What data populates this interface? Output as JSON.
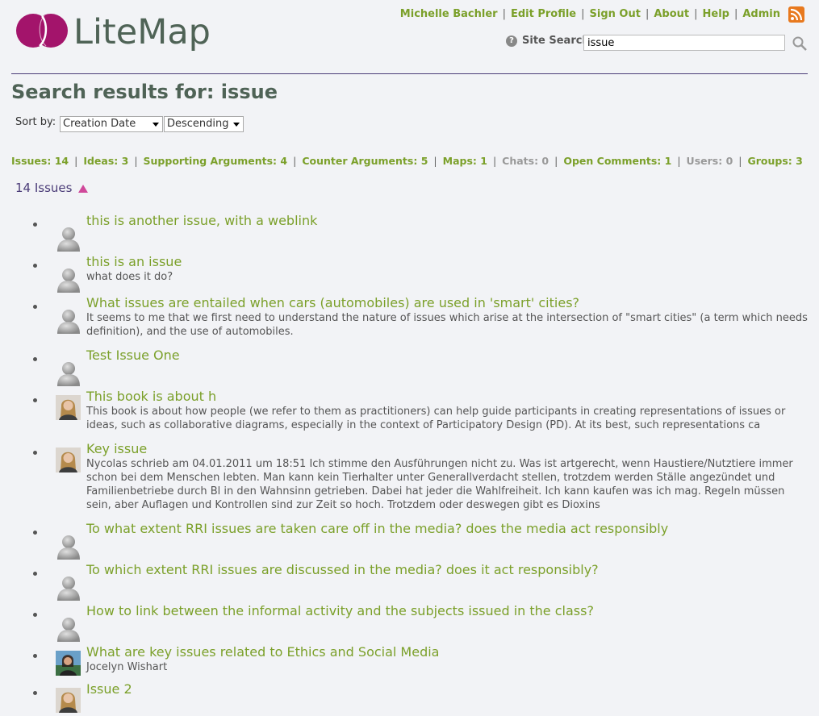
{
  "app": {
    "logo_text": "LiteMap"
  },
  "topnav": {
    "user": "Michelle Bachler",
    "edit_profile": "Edit Profile",
    "sign_out": "Sign Out",
    "about": "About",
    "help": "Help",
    "admin": "Admin"
  },
  "search": {
    "help_glyph": "?",
    "label": "Site Search",
    "value": "issue"
  },
  "page": {
    "title": "Search results for: issue"
  },
  "sort": {
    "label": "Sort by:",
    "field": "Creation Date",
    "order": "Descending"
  },
  "counts": [
    {
      "label": "Issues: 14",
      "active": true
    },
    {
      "label": "Ideas: 3",
      "active": true
    },
    {
      "label": "Supporting Arguments: 4",
      "active": true
    },
    {
      "label": "Counter Arguments: 5",
      "active": true
    },
    {
      "label": "Maps: 1",
      "active": true
    },
    {
      "label": "Chats: 0",
      "active": false
    },
    {
      "label": "Open Comments: 1",
      "active": true
    },
    {
      "label": "Users: 0",
      "active": false
    },
    {
      "label": "Groups: 3",
      "active": true
    }
  ],
  "section": {
    "heading": "14 Issues"
  },
  "issues": [
    {
      "title": "this is another issue, with a weblink",
      "desc": "",
      "avatar": "default"
    },
    {
      "title": "this is an issue",
      "desc": "what does it do?",
      "avatar": "default"
    },
    {
      "title": "What issues are entailed when cars (automobiles) are used in 'smart' cities?",
      "desc": "It seems to me that we first need to understand the nature of issues which arise at the intersection of \"smart cities\" (a term which needs definition), and the use of automobiles.",
      "avatar": "default"
    },
    {
      "title": "Test Issue One",
      "desc": "",
      "avatar": "default"
    },
    {
      "title": "This book is about h",
      "desc": "This book is about how people (we refer to them as practitioners) can help guide participants in creating representations of issues or ideas, such as collaborative diagrams, especially in the context of Participatory Design (PD). At its best, such representations ca",
      "avatar": "photo-woman"
    },
    {
      "title": "Key issue",
      "desc": "Nycolas schrieb am 04.01.2011 um 18:51 Ich stimme den Ausführungen nicht zu. Was ist artgerecht, wenn Haustiere/Nutztiere immer schon bei dem Menschen lebten. Man kann kein Tierhalter unter Generallverdacht stellen, trotzdem werden Ställe angezündet und Familienbetriebe durch Bl in den Wahnsinn getrieben. Dabei hat jeder die Wahlfreiheit. Ich kann kaufen was ich mag. Regeln müssen sein, aber Auflagen und Kontrollen sind zur Zeit so hoch. Trotzdem oder deswegen gibt es Dioxins",
      "avatar": "photo-woman"
    },
    {
      "title": "To what extent RRI issues are taken care off in the media? does the media act responsibly",
      "desc": "",
      "avatar": "default"
    },
    {
      "title": "To which extent RRI issues are discussed in the media? does it act responsibly?",
      "desc": "",
      "avatar": "default"
    },
    {
      "title": "How to link between the informal activity and the subjects issued in the class?",
      "desc": "",
      "avatar": "default"
    },
    {
      "title": "What are key issues related to Ethics and Social Media",
      "desc": "Jocelyn Wishart",
      "avatar": "photo-jocelyn"
    },
    {
      "title": "Issue 2",
      "desc": "",
      "avatar": "photo-woman"
    }
  ],
  "colors": {
    "link": "#7ba02a",
    "brand": "#4f6356",
    "accent": "#4b3c78",
    "logo": "#a3146b"
  }
}
